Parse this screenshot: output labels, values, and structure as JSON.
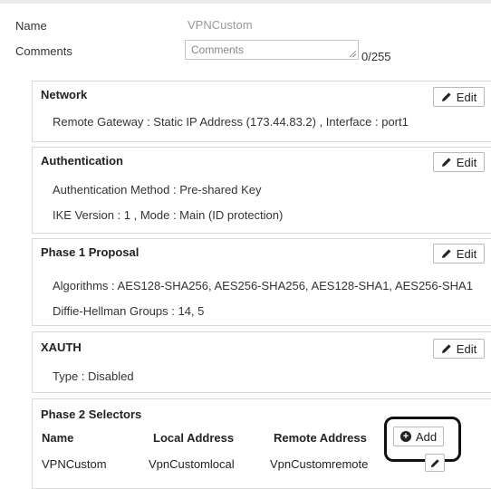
{
  "form": {
    "name_label": "Name",
    "name_value": "VPNCustom",
    "comments_label": "Comments",
    "comments_placeholder": "Comments",
    "comments_counter": "0/255"
  },
  "edit_label": "Edit",
  "network": {
    "title": "Network",
    "line1": "Remote Gateway : Static IP Address (173.44.83.2) , Interface : port1"
  },
  "authentication": {
    "title": "Authentication",
    "line1": "Authentication Method : Pre-shared Key",
    "line2": "IKE Version : 1 , Mode : Main (ID protection)"
  },
  "phase1": {
    "title": "Phase 1 Proposal",
    "line1": "Algorithms : AES128-SHA256, AES256-SHA256, AES128-SHA1, AES256-SHA1",
    "line2": "Diffie-Hellman Groups : 14, 5"
  },
  "xauth": {
    "title": "XAUTH",
    "line1": "Type : Disabled"
  },
  "phase2": {
    "title": "Phase 2 Selectors",
    "columns": [
      "Name",
      "Local Address",
      "Remote Address"
    ],
    "add_label": "Add",
    "rows": [
      {
        "name": "VPNCustom",
        "local": "VpnCustomlocal",
        "remote": "VpnCustomremote"
      }
    ]
  },
  "icons": {
    "edit": "pencil-icon",
    "add": "plus-circle-icon"
  },
  "colors": {
    "border": "#d9d9d9",
    "annotation": "#111111",
    "muted_text": "#999999"
  }
}
